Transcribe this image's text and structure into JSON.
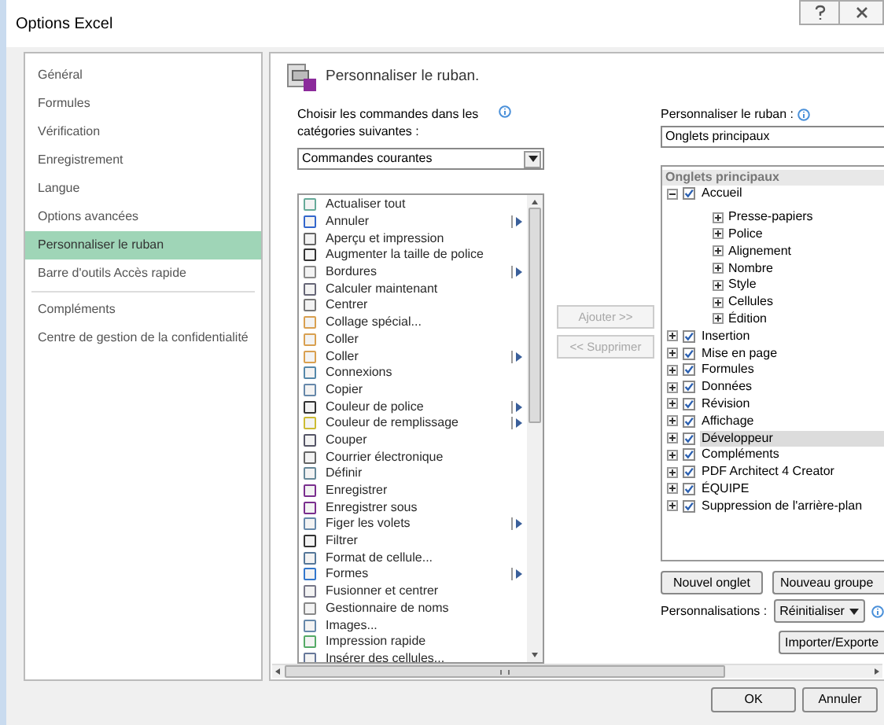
{
  "window": {
    "title": "Options Excel"
  },
  "sidebar": {
    "items": [
      {
        "label": "Général",
        "selected": false
      },
      {
        "label": "Formules",
        "selected": false
      },
      {
        "label": "Vérification",
        "selected": false
      },
      {
        "label": "Enregistrement",
        "selected": false
      },
      {
        "label": "Langue",
        "selected": false
      },
      {
        "label": "Options avancées",
        "selected": false
      },
      {
        "label": "Personnaliser le ruban",
        "selected": true
      },
      {
        "label": "Barre d'outils Accès rapide",
        "selected": false
      },
      {
        "label": "Compléments",
        "selected": false
      },
      {
        "label": "Centre de gestion de la confidentialité",
        "selected": false
      }
    ]
  },
  "header": "Personnaliser le ruban.",
  "commands": {
    "label": "Choisir les commandes dans les catégories suivantes :",
    "dropdown": "Commandes courantes",
    "items": [
      {
        "label": "Actualiser tout",
        "submenu": false
      },
      {
        "label": "Annuler",
        "submenu": true
      },
      {
        "label": "Aperçu et impression",
        "submenu": false
      },
      {
        "label": "Augmenter la taille de police",
        "submenu": false
      },
      {
        "label": "Bordures",
        "submenu": true
      },
      {
        "label": "Calculer maintenant",
        "submenu": false
      },
      {
        "label": "Centrer",
        "submenu": false
      },
      {
        "label": "Collage spécial...",
        "submenu": false
      },
      {
        "label": "Coller",
        "submenu": false
      },
      {
        "label": "Coller",
        "submenu": true
      },
      {
        "label": "Connexions",
        "submenu": false
      },
      {
        "label": "Copier",
        "submenu": false
      },
      {
        "label": "Couleur de police",
        "submenu": true
      },
      {
        "label": "Couleur de remplissage",
        "submenu": true
      },
      {
        "label": "Couper",
        "submenu": false
      },
      {
        "label": "Courrier électronique",
        "submenu": false
      },
      {
        "label": "Définir",
        "submenu": false
      },
      {
        "label": "Enregistrer",
        "submenu": false
      },
      {
        "label": "Enregistrer sous",
        "submenu": false
      },
      {
        "label": "Figer les volets",
        "submenu": true
      },
      {
        "label": "Filtrer",
        "submenu": false
      },
      {
        "label": "Format de cellule...",
        "submenu": false
      },
      {
        "label": "Formes",
        "submenu": true
      },
      {
        "label": "Fusionner et centrer",
        "submenu": false
      },
      {
        "label": "Gestionnaire de noms",
        "submenu": false
      },
      {
        "label": "Images...",
        "submenu": false
      },
      {
        "label": "Impression rapide",
        "submenu": false
      },
      {
        "label": "Insérer des cellules...",
        "submenu": false
      }
    ]
  },
  "add_button": {
    "label": "Ajouter >>",
    "disabled": true
  },
  "remove_button": {
    "label": "<< Supprimer",
    "disabled": true
  },
  "ribbon": {
    "label": "Personnaliser le ruban :",
    "dropdown": "Onglets principaux",
    "tree_header": "Onglets principaux",
    "tabs": [
      {
        "label": "Accueil",
        "checked": true,
        "expanded": true,
        "selected": false,
        "children": [
          {
            "label": "Presse-papiers"
          },
          {
            "label": "Police"
          },
          {
            "label": "Alignement"
          },
          {
            "label": "Nombre"
          },
          {
            "label": "Style"
          },
          {
            "label": "Cellules"
          },
          {
            "label": "Édition"
          }
        ]
      },
      {
        "label": "Insertion",
        "checked": true,
        "expanded": false,
        "selected": false
      },
      {
        "label": "Mise en page",
        "checked": true,
        "expanded": false,
        "selected": false
      },
      {
        "label": "Formules",
        "checked": true,
        "expanded": false,
        "selected": false
      },
      {
        "label": "Données",
        "checked": true,
        "expanded": false,
        "selected": false
      },
      {
        "label": "Révision",
        "checked": true,
        "expanded": false,
        "selected": false
      },
      {
        "label": "Affichage",
        "checked": true,
        "expanded": false,
        "selected": false
      },
      {
        "label": "Développeur",
        "checked": true,
        "expanded": false,
        "selected": true
      },
      {
        "label": "Compléments",
        "checked": true,
        "expanded": false,
        "selected": false
      },
      {
        "label": "PDF Architect 4 Creator",
        "checked": true,
        "expanded": false,
        "selected": false
      },
      {
        "label": "ÉQUIPE",
        "checked": true,
        "expanded": false,
        "selected": false
      },
      {
        "label": "Suppression de l'arrière-plan",
        "checked": true,
        "expanded": false,
        "selected": false
      }
    ]
  },
  "new_tab_button": "Nouvel onglet",
  "new_group_button": "Nouveau groupe",
  "customizations_label": "Personnalisations :",
  "reset_button": "Réinitialiser",
  "import_export_button": "Importer/Exporte",
  "footer": {
    "ok": "OK",
    "cancel": "Annuler"
  }
}
